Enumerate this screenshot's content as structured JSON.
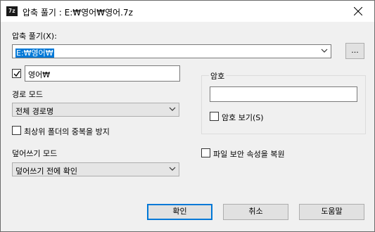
{
  "window": {
    "title": "압축 풀기 : E:₩영어₩영어.7z",
    "app_icon_text": "7z"
  },
  "extract": {
    "label": "압축 풀기(X):",
    "path_value": "E:₩영어₩",
    "browse_label": "..."
  },
  "folder_name": {
    "checked": true,
    "value": "영어₩"
  },
  "path_mode": {
    "label": "경로 모드",
    "value": "전체 경로명"
  },
  "eliminate_duplication": {
    "label": "최상위 폴더의 중복을 방지",
    "checked": false
  },
  "overwrite_mode": {
    "label": "덮어쓰기 모드",
    "value": "덮어쓰기 전에 확인"
  },
  "password": {
    "group_label": "암호",
    "value": "",
    "show_label": "암호 보기(S)",
    "show_checked": false
  },
  "restore_security": {
    "label": "파일 보안 속성을 복원",
    "checked": false
  },
  "buttons": {
    "ok": "확인",
    "cancel": "취소",
    "help": "도움말"
  },
  "colors": {
    "accent": "#0078d7",
    "dialog_bg": "#f0f0f0"
  }
}
